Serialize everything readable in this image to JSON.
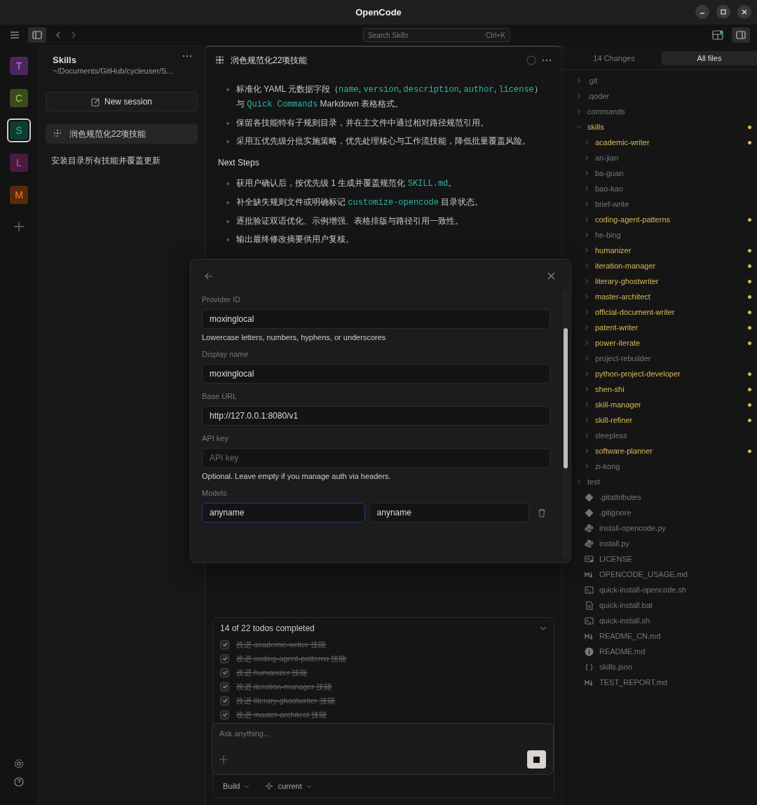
{
  "window": {
    "title": "OpenCode"
  },
  "toolbar": {
    "search": {
      "placeholder": "Search Skills",
      "shortcut": "Ctrl+K"
    }
  },
  "projects": [
    {
      "letter": "T",
      "color": "#4a2660",
      "selected": false
    },
    {
      "letter": "C",
      "color": "#3a4a1a",
      "selected": false
    },
    {
      "letter": "S",
      "color": "#0f3d33",
      "selected": true
    },
    {
      "letter": "L",
      "color": "#4a1a40",
      "selected": false
    },
    {
      "letter": "M",
      "color": "#5a2a0a",
      "selected": false
    }
  ],
  "sidebar": {
    "title": "Skills",
    "path": "~/Documents/GitHub/cycleuser/S...",
    "new_session": "New session",
    "sessions": [
      {
        "title": "润色规范化22项技能",
        "selected": true,
        "busy": true
      },
      {
        "title": "安装目录所有技能并覆盖更新",
        "selected": false,
        "busy": false
      }
    ]
  },
  "session": {
    "title": "润色规范化22项技能",
    "bullets_top": [
      [
        {
          "text": "标准化 YAML 元数据字段（",
          "code": false
        },
        {
          "text": "name",
          "code": true
        },
        {
          "text": ", ",
          "code": false
        },
        {
          "text": "version",
          "code": true
        },
        {
          "text": ", ",
          "code": false
        },
        {
          "text": "description",
          "code": true
        },
        {
          "text": ", ",
          "code": false
        },
        {
          "text": "author",
          "code": true
        },
        {
          "text": ", ",
          "code": false
        },
        {
          "text": "license",
          "code": true
        },
        {
          "text": "）与 ",
          "code": false
        },
        {
          "text": "Quick Commands",
          "code": true
        },
        {
          "text": " Markdown 表格格式。",
          "code": false
        }
      ],
      [
        {
          "text": "保留各技能特有子规则目录，并在主文件中通过相对路径规范引用。",
          "code": false
        }
      ],
      [
        {
          "text": "采用五优先级分批实施策略，优先处理核心与工作流技能，降低批量覆盖风险。",
          "code": false
        }
      ]
    ],
    "heading": "Next Steps",
    "bullets_next": [
      [
        {
          "text": "获用户确认后，按优先级 1 生成并覆盖规范化 ",
          "code": false
        },
        {
          "text": "SKILL.md",
          "code": true
        },
        {
          "text": "。",
          "code": false
        }
      ],
      [
        {
          "text": "补全缺失规则文件或明确标记 ",
          "code": false
        },
        {
          "text": "customize-opencode",
          "code": true
        },
        {
          "text": " 目录状态。",
          "code": false
        }
      ],
      [
        {
          "text": "逐批验证双语优化、示例增强、表格排版与路径引用一致性。",
          "code": false
        }
      ],
      [
        {
          "text": "输出最终修改摘要供用户复核。",
          "code": false
        }
      ]
    ],
    "todos": {
      "summary": "14 of 22 todos completed",
      "items": [
        {
          "text": "改进 academic-writer 技能",
          "checked": true
        },
        {
          "text": "改进 coding-agent-patterns 技能",
          "checked": true
        },
        {
          "text": "改进 humanizer 技能",
          "checked": true
        },
        {
          "text": "改进 iteration-manager 技能",
          "checked": true
        },
        {
          "text": "改进 literary-ghostwriter 技能",
          "checked": true
        },
        {
          "text": "改进 master-architect 技能",
          "checked": true
        }
      ]
    },
    "prompt": {
      "placeholder": "Ask anything..."
    },
    "footer": {
      "agent": "Build",
      "model": "current"
    }
  },
  "dialog": {
    "fields": [
      {
        "label": "Provider ID",
        "value": "moxinglocal",
        "hint": "Lowercase letters, numbers, hyphens, or underscores"
      },
      {
        "label": "Display name",
        "value": "moxinglocal"
      },
      {
        "label": "Base URL",
        "value": "http://127.0.0.1:8080/v1"
      },
      {
        "label": "API key",
        "placeholder": "API key",
        "hint": "Optional. Leave empty if you manage auth via headers."
      }
    ],
    "models": {
      "label": "Models",
      "inputs": [
        {
          "value": "anyname",
          "focused": true
        },
        {
          "value": "anyname",
          "focused": false
        }
      ]
    }
  },
  "files": {
    "tabs": [
      {
        "label": "14 Changes",
        "selected": false
      },
      {
        "label": "All files",
        "selected": true
      }
    ],
    "tree": [
      {
        "name": ".git",
        "kind": "folder",
        "expanded": false,
        "modified": false
      },
      {
        "name": ".qoder",
        "kind": "folder",
        "expanded": false,
        "modified": false
      },
      {
        "name": "commands",
        "kind": "folder",
        "expanded": false,
        "modified": false
      },
      {
        "name": "skills",
        "kind": "folder",
        "expanded": true,
        "modified": true,
        "children": [
          {
            "name": "academic-writer",
            "expanded": false,
            "modified": true
          },
          {
            "name": "an-jian",
            "expanded": false,
            "modified": false
          },
          {
            "name": "ba-guan",
            "expanded": false,
            "modified": false
          },
          {
            "name": "bao-kao",
            "expanded": false,
            "modified": false
          },
          {
            "name": "brief-write",
            "expanded": false,
            "modified": false
          },
          {
            "name": "coding-agent-patterns",
            "expanded": false,
            "modified": true
          },
          {
            "name": "he-bing",
            "expanded": false,
            "modified": false
          },
          {
            "name": "humanizer",
            "expanded": false,
            "modified": true
          },
          {
            "name": "iteration-manager",
            "expanded": false,
            "modified": true
          },
          {
            "name": "literary-ghostwriter",
            "expanded": false,
            "modified": true
          },
          {
            "name": "master-architect",
            "expanded": false,
            "modified": true
          },
          {
            "name": "official-document-writer",
            "expanded": false,
            "modified": true
          },
          {
            "name": "patent-writer",
            "expanded": false,
            "modified": true
          },
          {
            "name": "power-iterate",
            "expanded": false,
            "modified": true
          },
          {
            "name": "project-rebuilder",
            "expanded": false,
            "modified": false
          },
          {
            "name": "python-project-developer",
            "expanded": false,
            "modified": true
          },
          {
            "name": "shen-shi",
            "expanded": false,
            "modified": true
          },
          {
            "name": "skill-manager",
            "expanded": false,
            "modified": true
          },
          {
            "name": "skill-refiner",
            "expanded": false,
            "modified": true
          },
          {
            "name": "sleepless",
            "expanded": false,
            "modified": false
          },
          {
            "name": "software-planner",
            "expanded": false,
            "modified": true
          },
          {
            "name": "zi-kong",
            "expanded": false,
            "modified": false
          }
        ]
      },
      {
        "name": "test",
        "kind": "folder",
        "expanded": false,
        "modified": false
      },
      {
        "name": ".gitattributes",
        "kind": "git",
        "modified": false
      },
      {
        "name": ".gitignore",
        "kind": "git",
        "modified": false
      },
      {
        "name": "install-opencode.py",
        "kind": "python",
        "modified": false
      },
      {
        "name": "install.py",
        "kind": "python",
        "modified": false
      },
      {
        "name": "LICENSE",
        "kind": "license",
        "modified": false
      },
      {
        "name": "OPENCODE_USAGE.md",
        "kind": "markdown",
        "modified": false
      },
      {
        "name": "quick-install-opencode.sh",
        "kind": "terminal",
        "modified": false
      },
      {
        "name": "quick-install.bat",
        "kind": "document",
        "modified": false
      },
      {
        "name": "quick-install.sh",
        "kind": "terminal",
        "modified": false
      },
      {
        "name": "README_CN.md",
        "kind": "markdown",
        "modified": false
      },
      {
        "name": "README.md",
        "kind": "info",
        "modified": false
      },
      {
        "name": "skills.json",
        "kind": "json",
        "modified": false
      },
      {
        "name": "TEST_REPORT.md",
        "kind": "markdown",
        "modified": false
      }
    ]
  }
}
